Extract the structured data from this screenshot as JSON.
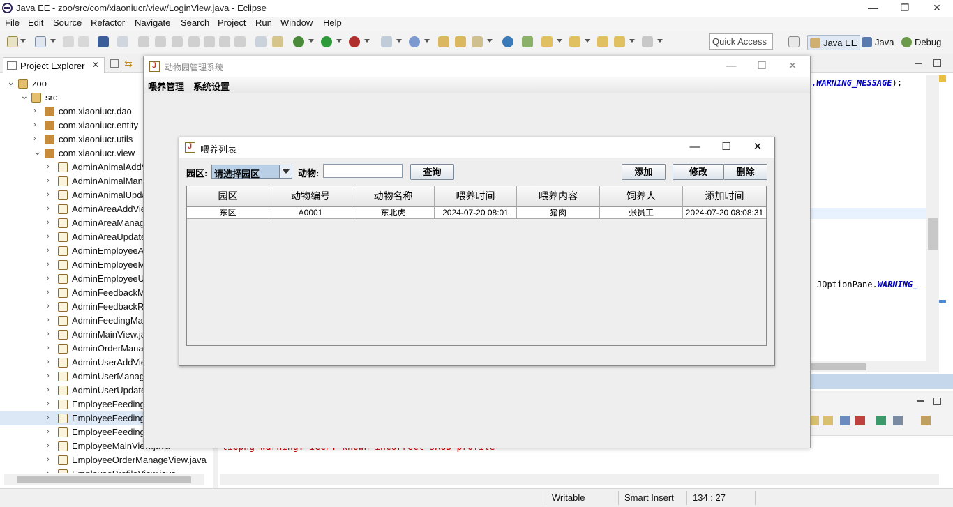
{
  "window": {
    "title": "Java EE - zoo/src/com/xiaoniucr/view/LoginView.java - Eclipse"
  },
  "menu": [
    "File",
    "Edit",
    "Source",
    "Refactor",
    "Navigate",
    "Search",
    "Project",
    "Run",
    "Window",
    "Help"
  ],
  "toolbar": {
    "quick_access": "Quick Access"
  },
  "perspectives": [
    "Java EE",
    "Java",
    "Debug"
  ],
  "explorer": {
    "tab_label": "Project Explorer",
    "tree": [
      {
        "label": "zoo",
        "type": "project",
        "depth": 0,
        "expanded": true
      },
      {
        "label": "src",
        "type": "srcfolder",
        "depth": 1,
        "expanded": true
      },
      {
        "label": "com.xiaoniucr.dao",
        "type": "package",
        "depth": 2,
        "expanded": false
      },
      {
        "label": "com.xiaoniucr.entity",
        "type": "package",
        "depth": 2,
        "expanded": false
      },
      {
        "label": "com.xiaoniucr.utils",
        "type": "package",
        "depth": 2,
        "expanded": false
      },
      {
        "label": "com.xiaoniucr.view",
        "type": "package",
        "depth": 2,
        "expanded": true
      },
      {
        "label": "AdminAnimalAddView.java",
        "type": "java",
        "depth": 3
      },
      {
        "label": "AdminAnimalManageView.java",
        "type": "java",
        "depth": 3
      },
      {
        "label": "AdminAnimalUpdateView.java",
        "type": "java",
        "depth": 3
      },
      {
        "label": "AdminAreaAddView.java",
        "type": "java",
        "depth": 3
      },
      {
        "label": "AdminAreaManageView.java",
        "type": "java",
        "depth": 3
      },
      {
        "label": "AdminAreaUpdateView.java",
        "type": "java",
        "depth": 3
      },
      {
        "label": "AdminEmployeeAddView.java",
        "type": "java",
        "depth": 3
      },
      {
        "label": "AdminEmployeeManageView.java",
        "type": "java",
        "depth": 3
      },
      {
        "label": "AdminEmployeeUpdateView.java",
        "type": "java",
        "depth": 3
      },
      {
        "label": "AdminFeedbackManageView.java",
        "type": "java",
        "depth": 3
      },
      {
        "label": "AdminFeedbackReplyView.java",
        "type": "java",
        "depth": 3
      },
      {
        "label": "AdminFeedingManageView.java",
        "type": "java",
        "depth": 3
      },
      {
        "label": "AdminMainView.java",
        "type": "java",
        "depth": 3
      },
      {
        "label": "AdminOrderManageView.java",
        "type": "java",
        "depth": 3
      },
      {
        "label": "AdminUserAddView.java",
        "type": "java",
        "depth": 3
      },
      {
        "label": "AdminUserManageView.java",
        "type": "java",
        "depth": 3
      },
      {
        "label": "AdminUserUpdateView.java",
        "type": "java",
        "depth": 3
      },
      {
        "label": "EmployeeFeedingAddView.java",
        "type": "java",
        "depth": 3
      },
      {
        "label": "EmployeeFeedingManageView.java",
        "type": "java",
        "depth": 3,
        "selected": true
      },
      {
        "label": "EmployeeFeedingUpdateView.java",
        "type": "java",
        "depth": 3
      },
      {
        "label": "EmployeeMainView.java",
        "type": "java",
        "depth": 3
      },
      {
        "label": "EmployeeOrderManageView.java",
        "type": "java",
        "depth": 3
      },
      {
        "label": "EmployeeProfileView.java",
        "type": "java",
        "depth": 3
      }
    ]
  },
  "editor": {
    "line1_const": ".WARNING_MESSAGE",
    "line1_tail": ");",
    "line2_pre": "JOptionPane.",
    "line2_const": "WARNING_"
  },
  "console": {
    "text": "libpng warning: iCCP: known incorrect sRGB profile"
  },
  "status": {
    "writable": "Writable",
    "insert_mode": "Smart Insert",
    "position": "134 : 27"
  },
  "zoo_app": {
    "title": "动物园管理系统",
    "menus": [
      "喂养管理",
      "系统设置"
    ]
  },
  "feeding_list": {
    "title": "喂养列表",
    "area_label": "园区:",
    "area_selected": "请选择园区",
    "animal_label": "动物:",
    "animal_value": "",
    "buttons": {
      "search": "查询",
      "add": "添加",
      "edit": "修改",
      "delete": "删除"
    },
    "columns": [
      "园区",
      "动物编号",
      "动物名称",
      "喂养时间",
      "喂养内容",
      "饲养人",
      "添加时间"
    ],
    "rows": [
      [
        "东区",
        "A0001",
        "东北虎",
        "2024-07-20 08:01",
        "猪肉",
        "张员工",
        "2024-07-20 08:08:31"
      ]
    ]
  }
}
